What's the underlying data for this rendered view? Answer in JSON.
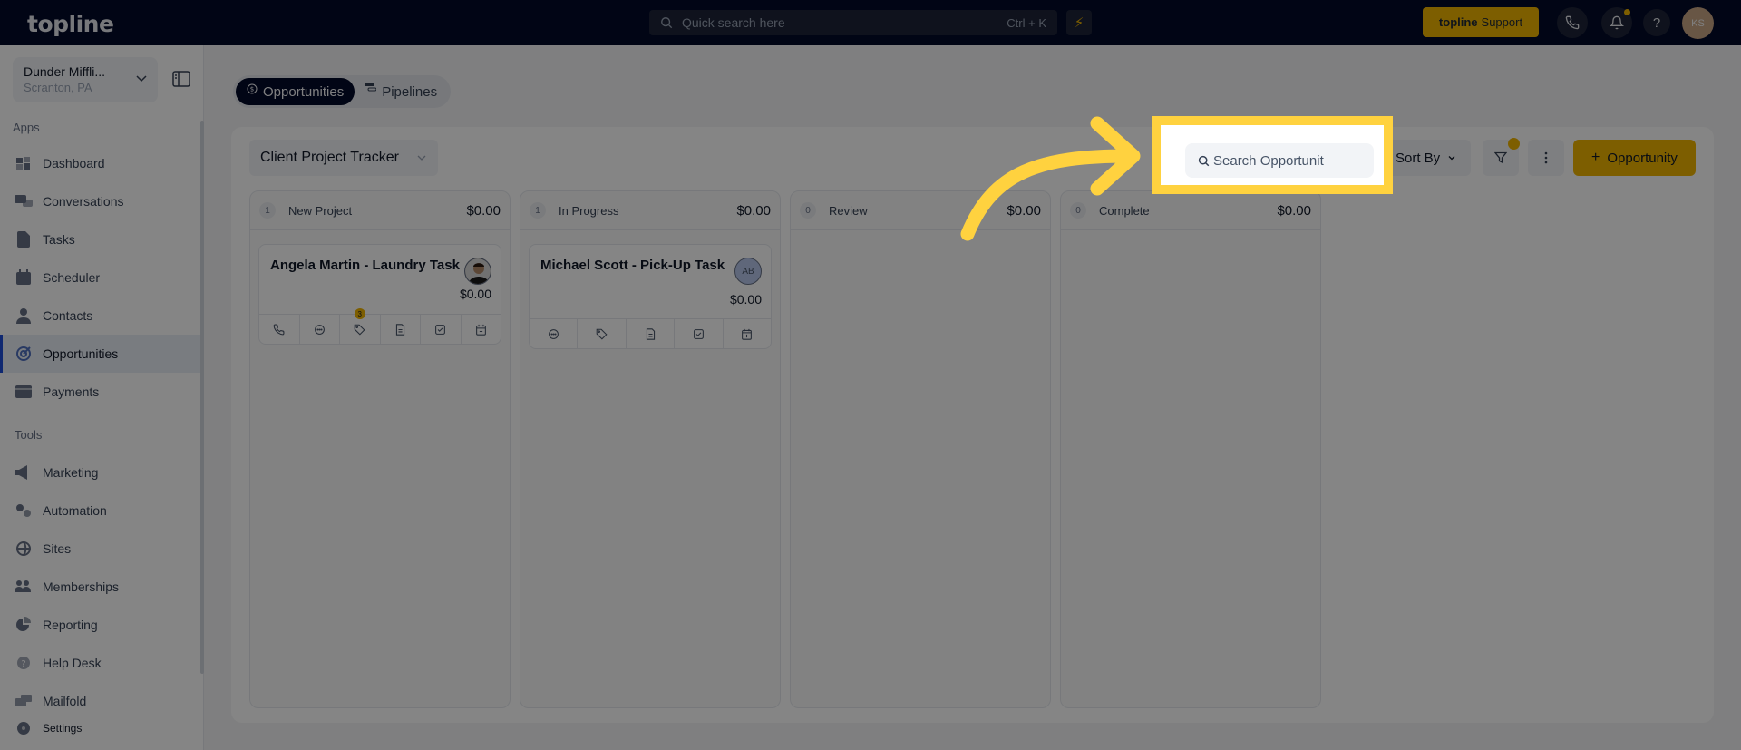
{
  "topbar": {
    "logo": "topline",
    "quick_search_placeholder": "Quick search here",
    "quick_search_shortcut": "Ctrl + K",
    "support_brand": "topline",
    "support_label": "Support",
    "user_initials": "KS",
    "accent_color": "#f0b400"
  },
  "sidebar": {
    "location": {
      "name": "Dunder Miffli...",
      "city": "Scranton, PA"
    },
    "apps_label": "Apps",
    "apps": [
      {
        "label": "Dashboard",
        "icon": "dashboard-icon"
      },
      {
        "label": "Conversations",
        "icon": "chat-icon"
      },
      {
        "label": "Tasks",
        "icon": "task-icon"
      },
      {
        "label": "Scheduler",
        "icon": "calendar-icon"
      },
      {
        "label": "Contacts",
        "icon": "person-icon"
      },
      {
        "label": "Opportunities",
        "icon": "target-icon",
        "active": true
      },
      {
        "label": "Payments",
        "icon": "credit-card-icon"
      }
    ],
    "tools_label": "Tools",
    "tools": [
      {
        "label": "Marketing",
        "icon": "megaphone-icon"
      },
      {
        "label": "Automation",
        "icon": "gears-icon"
      },
      {
        "label": "Sites",
        "icon": "globe-icon"
      },
      {
        "label": "Memberships",
        "icon": "users-icon"
      },
      {
        "label": "Reporting",
        "icon": "pie-chart-icon"
      },
      {
        "label": "Help Desk",
        "icon": "help-icon"
      },
      {
        "label": "Mailfold",
        "icon": "mail-icon"
      }
    ],
    "settings_label": "Settings"
  },
  "main": {
    "tabs": [
      {
        "label": "Opportunities",
        "active": true
      },
      {
        "label": "Pipelines",
        "active": false
      }
    ],
    "pipeline": "Client Project Tracker",
    "search_placeholder": "Search Opportunit",
    "sort_label": "Sort By",
    "add_label": "Opportunity",
    "columns": [
      {
        "count": "1",
        "title": "New Project",
        "amount": "$0.00"
      },
      {
        "count": "1",
        "title": "In Progress",
        "amount": "$0.00"
      },
      {
        "count": "0",
        "title": "Review",
        "amount": "$0.00"
      },
      {
        "count": "0",
        "title": "Complete",
        "amount": "$0.00"
      }
    ],
    "cards": [
      {
        "title": "Angela Martin - Laundry Task",
        "amount": "$0.00",
        "avatar": "photo",
        "tag_count": "3"
      },
      {
        "title": "Michael Scott - Pick-Up Task",
        "amount": "$0.00",
        "avatar_initials": "AB"
      }
    ]
  },
  "annotation": {
    "highlight_color": "#ffd23f",
    "target": "search-opportunities-input"
  }
}
